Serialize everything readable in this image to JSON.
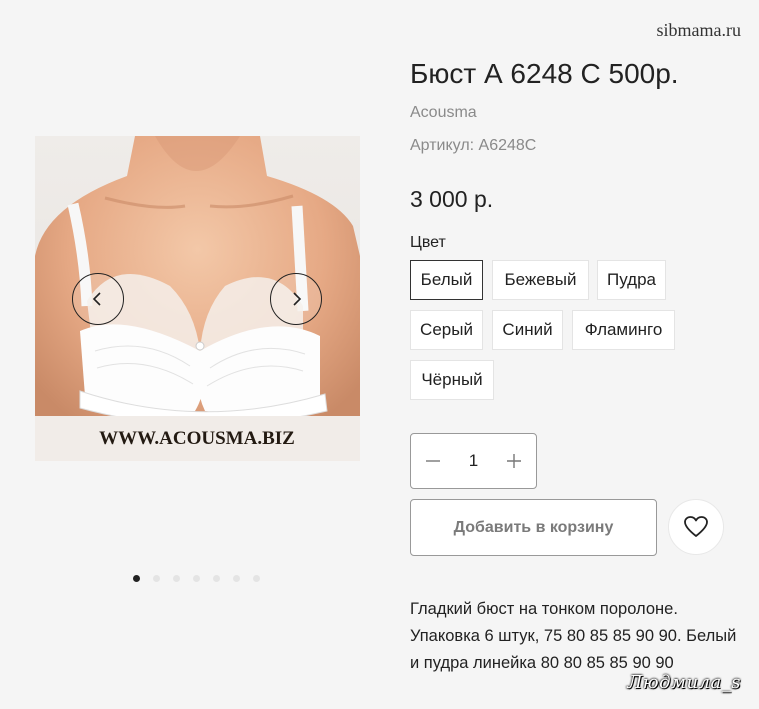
{
  "watermark": "sibmama.ru",
  "signature": "Людмила_s",
  "gallery": {
    "image_caption": "WWW.ACOUSMA.BIZ",
    "slide_count": 7,
    "active_slide": 1
  },
  "product": {
    "title": "Бюст А 6248 С 500р.",
    "brand": "Acousma",
    "sku": "Артикул: А6248С",
    "price": "3 000 р.",
    "color_label": "Цвет",
    "colors": [
      "Белый",
      "Бежевый",
      "Пудра",
      "Серый",
      "Синий",
      "Фламинго",
      "Чёрный"
    ],
    "selected_color": "Белый",
    "quantity": "1",
    "add_to_cart": "Добавить в корзину",
    "description": "Гладкий бюст на тонком поролоне. Упаковка 6 штук, 75 80 85 85 90 90. Белый и пудра линейка 80 80 85 85 90 90"
  },
  "icons": {
    "prev": "chevron-left-icon",
    "next": "chevron-right-icon",
    "minus": "minus-icon",
    "plus": "plus-icon",
    "wishlist": "heart-icon"
  }
}
